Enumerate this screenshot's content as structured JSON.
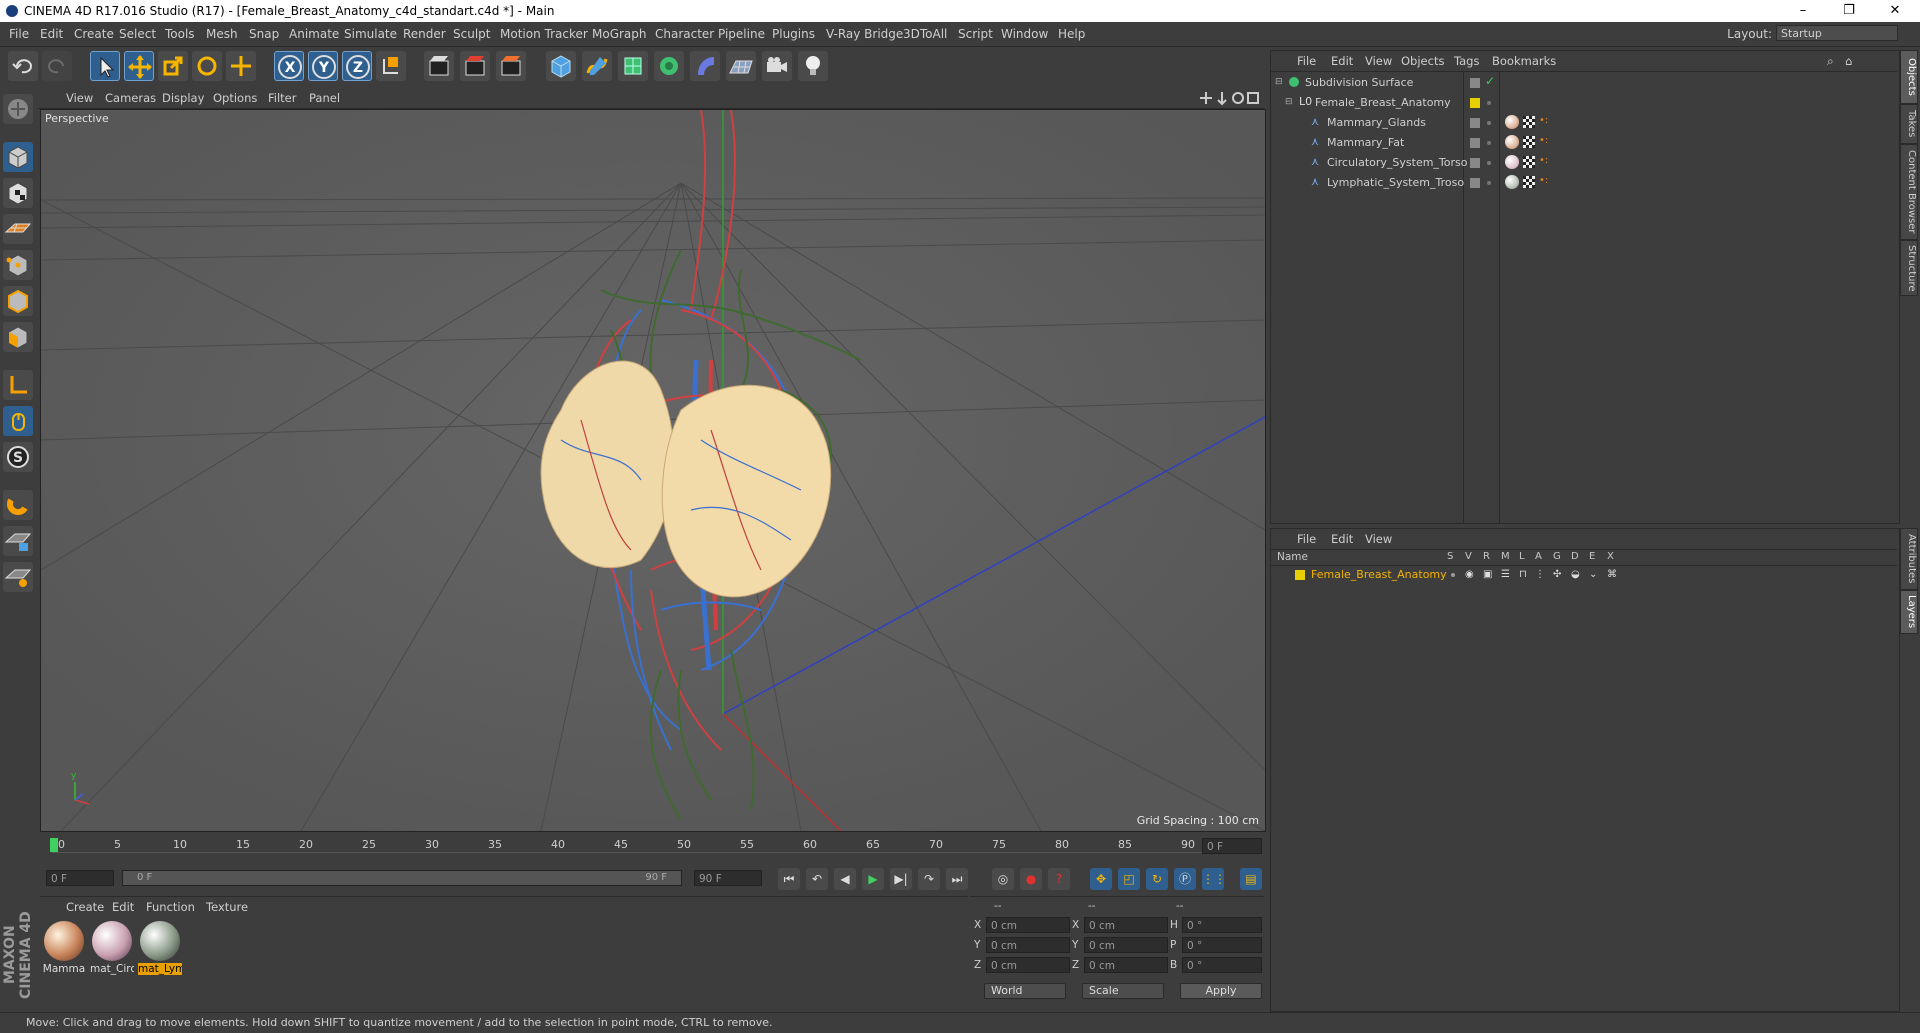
{
  "window": {
    "title": "CINEMA 4D R17.016 Studio (R17) - [Female_Breast_Anatomy_c4d_standart.c4d *] - Main",
    "minimize": "–",
    "maximize": "❐",
    "close": "✕"
  },
  "menu": [
    "File",
    "Edit",
    "Create",
    "Select",
    "Tools",
    "Mesh",
    "Snap",
    "Animate",
    "Simulate",
    "Render",
    "Sculpt",
    "Motion Tracker",
    "MoGraph",
    "Character",
    "Pipeline",
    "Plugins",
    "V-Ray Bridge",
    "3DToAll",
    "Script",
    "Window",
    "Help"
  ],
  "layout": {
    "label": "Layout:",
    "value": "Startup"
  },
  "toolbar_axes": {
    "x": "X",
    "y": "Y",
    "z": "Z"
  },
  "viewport": {
    "menu": [
      "View",
      "Cameras",
      "Display",
      "Options",
      "Filter",
      "Panel"
    ],
    "label": "Perspective",
    "grid_spacing": "Grid Spacing : 100 cm"
  },
  "timeline": {
    "ticks": [
      "0",
      "5",
      "10",
      "15",
      "20",
      "25",
      "30",
      "35",
      "40",
      "45",
      "50",
      "55",
      "60",
      "65",
      "70",
      "75",
      "80",
      "85",
      "90"
    ],
    "current_frame": "0 F",
    "start": "0 F",
    "range_start": "0 F",
    "range_end": "90 F",
    "end": "90 F"
  },
  "material_panel": {
    "menu": [
      "Create",
      "Edit",
      "Function",
      "Texture"
    ],
    "materials": [
      {
        "label": "Mamma",
        "selected": false,
        "color": "#c8845a"
      },
      {
        "label": "mat_Circ",
        "selected": false,
        "color": "#c9a0b0"
      },
      {
        "label": "mat_Lym",
        "selected": true,
        "color": "#8a9a88"
      }
    ]
  },
  "coords": {
    "headers": [
      "--",
      "--",
      "--"
    ],
    "rows": [
      {
        "a": "X",
        "av": "0 cm",
        "b": "X",
        "bv": "0 cm",
        "c": "H",
        "cv": "0 °"
      },
      {
        "a": "Y",
        "av": "0 cm",
        "b": "Y",
        "bv": "0 cm",
        "c": "P",
        "cv": "0 °"
      },
      {
        "a": "Z",
        "av": "0 cm",
        "b": "Z",
        "bv": "0 cm",
        "c": "B",
        "cv": "0 °"
      }
    ],
    "mode": "World",
    "scale": "Scale",
    "apply": "Apply"
  },
  "status": "Move: Click and drag to move elements. Hold down SHIFT to quantize movement / add to the selection in point mode, CTRL to remove.",
  "brand": "MAXON CINEMA 4D",
  "object_panel": {
    "menu": [
      "File",
      "Edit",
      "View",
      "Objects",
      "Tags",
      "Bookmarks"
    ],
    "objects": [
      {
        "name": "Subdivision Surface"
      },
      {
        "name": "Female_Breast_Anatomy"
      },
      {
        "name": "Mammary_Glands"
      },
      {
        "name": "Mammary_Fat"
      },
      {
        "name": "Circulatory_System_Torso"
      },
      {
        "name": "Lymphatic_System_Troso"
      }
    ]
  },
  "layer_panel": {
    "menu": [
      "File",
      "Edit",
      "View"
    ],
    "header_name": "Name",
    "columns": [
      "S",
      "V",
      "R",
      "M",
      "L",
      "A",
      "G",
      "D",
      "E",
      "X"
    ],
    "layers": [
      {
        "name": "Female_Breast_Anatomy"
      }
    ]
  },
  "side_tabs_top": [
    "Objects",
    "Takes",
    "Content Browser",
    "Structure"
  ],
  "side_tabs_bottom": [
    "Attributes",
    "Layers"
  ]
}
